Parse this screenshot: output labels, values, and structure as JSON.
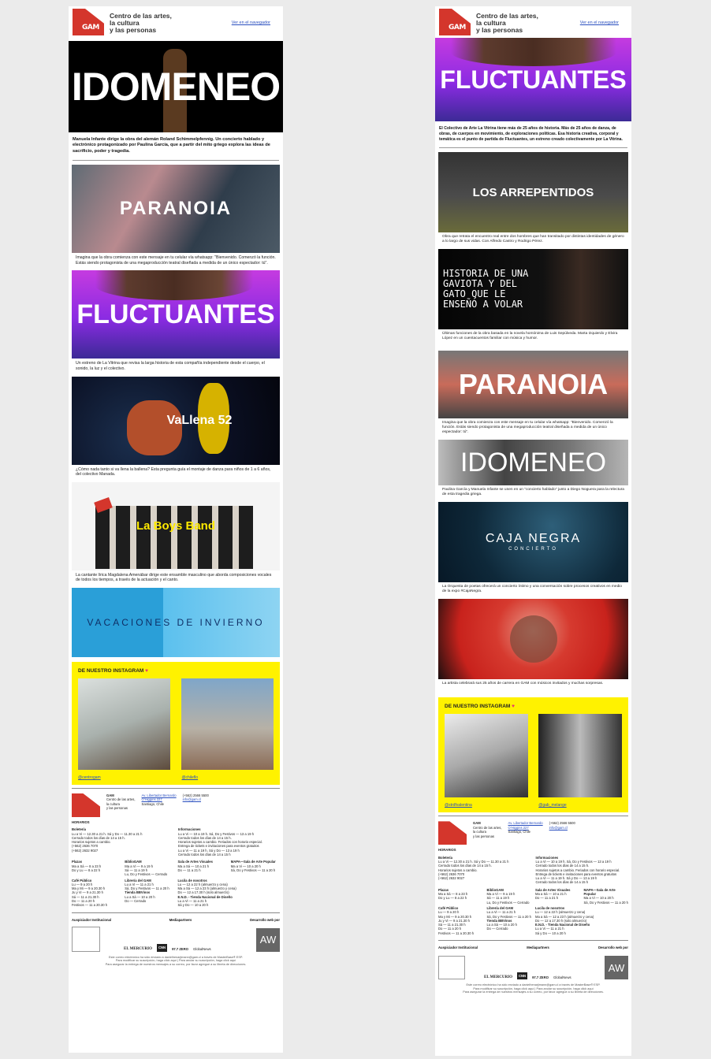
{
  "header": {
    "brand_lines": [
      "Centro de las artes,",
      "la cultura",
      "y las personas"
    ],
    "browser_link": "Ver en el navegador",
    "logo_text": "GAM"
  },
  "colors": {
    "brand_red": "#d4362c",
    "link_blue": "#2a4fbf",
    "instagram_yellow": "#fff200"
  },
  "left": {
    "hero_title": "IDOMENEO",
    "intro": "Manuela Infante dirige la obra del alemán Roland Schimmelpfennig. Un concierto hablado y electrónico protagonizado por Paulina García, que a partir del mito griego explora las ideas de sacrificio, poder y tragedia.",
    "events": [
      {
        "title": "PARANOIA",
        "desc": "Imagina que la obra comienza con este mensaje en tu celular vía whatsapp: \"Bienvenido. Comenzó la función. Estás siendo protagonista de una megaproducción teatral diseñada a medida de un único espectador: tú\"."
      },
      {
        "title": "FLUCTUANTES",
        "desc": "Un estreno de La Vitrina que revisa la larga historia de esta compañía independiente desde el cuerpo, el sonido, la luz y el colectivo."
      },
      {
        "title": "VaLlena 52",
        "desc": "¿Cómo nada tanto si va llena la ballena? Esta pregunta guía el montaje de danza para niños de 1 a 6 años, del colectivo Manada."
      },
      {
        "title": "La Boys Band",
        "desc": "La cantante lírica Magdalena Amenábar dirige este ensamble masculino que aborda composiciones vocales de todos los tiempos, a través de la actuación y el canto."
      },
      {
        "title": "VACACIONES DE INVIERNO",
        "desc": ""
      }
    ],
    "instagram": {
      "title": "DE NUESTRO INSTAGRAM",
      "handles": [
        "@centrogam",
        "@chileflo"
      ]
    }
  },
  "right": {
    "hero_title": "FLUCTUANTES",
    "intro": "El Colectivo de Arte La Vitrina tiene más de 25 años de historia. Más de 25 años de danza, de obras, de cuerpos en movimiento, de exploraciones políticas. Esa historia creativa, corporal y temática es el punto de partida de Fluctuantes, un estreno creado colectivamente por La Vitrina.",
    "events": [
      {
        "title": "LOS ARREPENTIDOS",
        "desc": "Obra que retrata el encuentro real entre dos hombres que han transitado por distintas identidades de género a lo largo de sus vidas. Con Alfredo Castro y Rodrigo Pérez."
      },
      {
        "title": "HISTORIA DE UNA GAVIOTA Y DEL GATO QUE LE ENSEÑÓ A VOLAR",
        "desc": "Últimas funciones de la obra basada en la novela homónima de Luis Sepúlveda. Marta Izquierdo y Elvira López en un cuentacuentos familiar con música y humor."
      },
      {
        "title": "PARANOIA",
        "desc": "Imagina que la obra comienza con este mensaje en tu celular vía whatsapp: \"Bienvenido. Comenzó la función. Estás siendo protagonista de una megaproducción teatral diseñada a medida de un único espectador: tú\"."
      },
      {
        "title": "IDOMENEO",
        "desc": "Paulina García y Manuela Infante se unen en un \"concierto hablado\" junto a Diego Noguera para la relectura de esta tragedia griega."
      },
      {
        "title": "CAJA NEGRA",
        "subtitle": "CONCIERTO",
        "desc": "La Orquesta de poetas ofrecerá un concierto íntimo y una conversación sobre procesos creativos en medio de la expo #CajaNegra."
      },
      {
        "title": "",
        "desc": "La artista celebrará sus 25 años de carrera en GAM con músicos invitados y muchas sorpresas."
      }
    ],
    "instagram": {
      "title": "DE NUESTRO INSTAGRAM",
      "handles": [
        "@strdfvalentina",
        "@gab_melange"
      ]
    }
  },
  "footer": {
    "org": [
      "GAM",
      "Centro de las artes,",
      "la cultura",
      "y las personas"
    ],
    "address": [
      "Av. Libertador Bernardo",
      "O'Higgins 227",
      "Santiago, Chile"
    ],
    "contact": [
      "(+562) 2566 5500",
      "info@gam.cl"
    ],
    "hours_title": "HORARIOS",
    "blocks": [
      {
        "title": "Boletería",
        "lines": [
          "Lu a Vi — 12.30 a 21 h. Sá y Do — 11.30 a 21 h",
          "Cerrado todos los días de 14 a 15 h.",
          "Horarios sujetos a cambio.",
          "(+562) 2636 7070",
          "(+562) 2632 9027"
        ]
      },
      {
        "title": "Informaciones",
        "lines": [
          "Lu a Vi — 10 a 19 h. Sá, Do y Festivos — 13 a 19 h",
          "Cerrado todos los días de 14 a 15 h.",
          "Horarios sujetos a cambio. Feriados con horario especial.",
          "",
          "Entrega de tickets e invitaciones para eventos gratuitos",
          "Lu a Vi — 11 a 19 h. Sá y Do — 13 a 19 h",
          "Cerrado todos los días de 14 a 15 h"
        ]
      },
      {
        "title": "Plazas",
        "lines": [
          "Ma a Sá — 8 a 23 h",
          "Do y Lu — 8 a 22 h"
        ]
      },
      {
        "title": "BiblioGAM",
        "lines": [
          "Ma a Vi — 9 a 19 h",
          "Sá — 11 a 19 h",
          "Lu, Do y Festivos — Cerrado"
        ]
      },
      {
        "title": "Sala de Artes Visuales",
        "lines": [
          "Ma a Sá — 10 a 21 h",
          "Do — 11 a 21 h"
        ]
      },
      {
        "title": "MAPA—Sala de Arte Popular",
        "lines": [
          "Ma a Vi — 10 a 20 h",
          "Sá, Do y Festivos — 11 a 20 h"
        ]
      },
      {
        "title": "Café Público",
        "lines": [
          "Lu — 9 a 20 h",
          "Ma y Mi — 9 a 20.30 h",
          "Ju y Vi — 9 a 21.30 h",
          "Sá — 11 a 21.30 h",
          "Do — 11 a 20 h",
          "Festivos — 11 a 20.30 h"
        ]
      },
      {
        "title": "Librería del GAM",
        "lines": [
          "Lu a Vi — 11 a 21 h",
          "Sá, Do y Festivos — 11 a 20 h"
        ]
      },
      {
        "title": "Lucila de nosotros",
        "lines": [
          "Lu — 12 a 22 h (almuerzo y cena)",
          "Ma a Sá — 12 a 23 h (almuerzo y cena)",
          "Do — 12 a 17.30 h (solo almuerzo)"
        ]
      },
      {
        "title": "Tienda BBVinos",
        "lines": [
          "Lu a Sá — 10 a 20 h",
          "Do — Cerrado"
        ]
      },
      {
        "title": "E.N.D. - Tienda Nacional de Diseño",
        "lines": [
          "Lu a Vi — 11 a 21 h",
          "Sá y Do — 10 a 20 h"
        ]
      }
    ],
    "sponsors": [
      "Auspiciador Institucional",
      "Mediapartners",
      "Desarrollo web por"
    ],
    "media": [
      "EL MERCURIO",
      "CNN",
      "97.7 ZERO",
      "GlobalNews"
    ],
    "dev": "AW",
    "legal": [
      "Este correo electrónico ha sido enviado a danielhenarjimann@gam.cl a través de MasterBase® ESP.",
      "Para modificar su suscripción, haga click aquí | Para anular su suscripción, haga click aquí",
      "Para asegurar la entrega de nuestros mensajes a su correo, por favor agregue a su libreta de direcciones."
    ]
  }
}
